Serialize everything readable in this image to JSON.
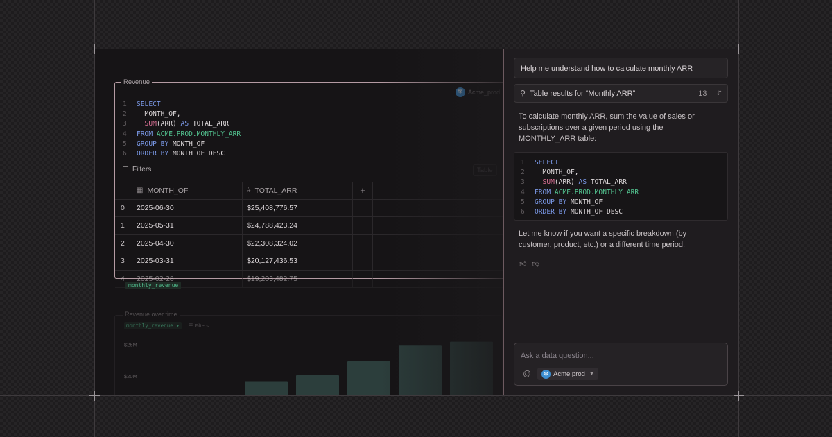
{
  "notebook": {
    "cell_label": "Revenue",
    "connection": "Acme_prod",
    "sql_lines": [
      {
        "n": "1",
        "parts": [
          {
            "t": "SELECT",
            "c": "kw"
          }
        ]
      },
      {
        "n": "2",
        "parts": [
          {
            "t": "  MONTH_OF,",
            "c": "id"
          }
        ]
      },
      {
        "n": "3",
        "parts": [
          {
            "t": "  SUM",
            "c": "fn"
          },
          {
            "t": "(ARR) ",
            "c": "id"
          },
          {
            "t": "AS",
            "c": "kw"
          },
          {
            "t": " TOTAL_ARR",
            "c": "id"
          }
        ]
      },
      {
        "n": "4",
        "parts": [
          {
            "t": "FROM ",
            "c": "kw"
          },
          {
            "t": "ACME.PROD.MONTHLY_ARR",
            "c": "tb"
          }
        ]
      },
      {
        "n": "5",
        "parts": [
          {
            "t": "GROUP BY",
            "c": "kw"
          },
          {
            "t": " MONTH_OF",
            "c": "id"
          }
        ]
      },
      {
        "n": "6",
        "parts": [
          {
            "t": "ORDER BY",
            "c": "kw"
          },
          {
            "t": " MONTH_OF DESC",
            "c": "id"
          }
        ]
      }
    ],
    "filters_label": "Filters",
    "table_label": "Table",
    "columns": [
      "MONTH_OF",
      "TOTAL_ARR"
    ],
    "add_column": "+",
    "rows": [
      {
        "idx": "0",
        "month": "2025-06-30",
        "arr": "$25,408,776.57"
      },
      {
        "idx": "1",
        "month": "2025-05-31",
        "arr": "$24,788,423.24"
      },
      {
        "idx": "2",
        "month": "2025-04-30",
        "arr": "$22,308,324.02"
      },
      {
        "idx": "3",
        "month": "2025-03-31",
        "arr": "$20,127,436.53"
      },
      {
        "idx": "4",
        "month": "2025-02-28",
        "arr": "$19,203,482.75"
      }
    ],
    "variable_name": "monthly_revenue",
    "chart_cell_label": "Revenue over time",
    "chart_variable": "monthly_revenue",
    "chart_filters": "Filters"
  },
  "chart_data": {
    "type": "bar",
    "title": "Revenue over time",
    "xlabel": "",
    "ylabel": "",
    "ytick_labels": [
      "$25M",
      "$20M"
    ],
    "values": [
      19203482.75,
      20127436.53,
      22308324.02,
      24788423.24,
      25408776.57
    ],
    "ylim": [
      15000000,
      27000000
    ],
    "color": "#3b5a56"
  },
  "assistant": {
    "user_prompt": "Help me understand how to calculate monthly ARR",
    "result_label": "Table results for “Monthly ARR”",
    "result_count": "13",
    "answer_intro": "To calculate monthly ARR, sum the value of sales or subscriptions over a given period using the MONTHLY_ARR table:",
    "answer_outro": "Let me know if you want a specific breakdown (by customer, product, etc.) or a different time period.",
    "ask_placeholder": "Ask a data question...",
    "at_symbol": "@",
    "connection": "Acme prod"
  },
  "colors": {
    "accent_border": "#b59ba3",
    "keyword": "#7a98e6",
    "function": "#d86f93",
    "table": "#52c28f",
    "snowflake": "#3d8fd3"
  }
}
